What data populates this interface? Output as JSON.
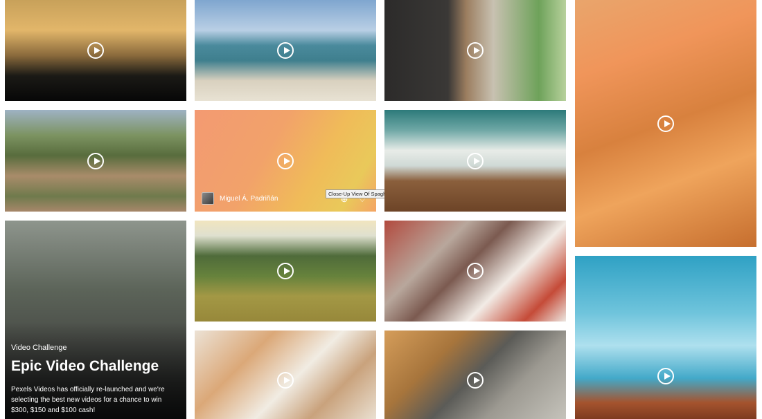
{
  "grid": {
    "tiles": [
      {
        "name": "sunset-coast-video",
        "bg": "linear-gradient(180deg,#c8a15a 0%,#e2b66a 30%,#8a6a3c 55%,#1b1a16 75%,#070707 100%)"
      },
      {
        "name": "beach-waves-video",
        "bg": "linear-gradient(180deg,#7fa6cf 0%,#b9cfe5 30%,#4a8a9c 45%,#3f7f8e 60%,#d9d1bf 80%,#e8e2d3 100%)"
      },
      {
        "name": "dog-window-video",
        "bg": "linear-gradient(90deg,#2c2b2a 0%,#3a3836 35%,#9b7d5f 45%,#c8c1b1 60%,#6ea25a 85%,#b7d19c 100%)"
      },
      {
        "name": "coffee-flowers-video",
        "bg": "linear-gradient(160deg,#e9a56c 0%,#f0955a 25%,#d8813e 50%,#efa45c 70%,#c66e2e 100%)"
      },
      {
        "name": "aerial-village-video",
        "bg": "linear-gradient(180deg,#9eb2c3 0%,#7c9361 25%,#586c3d 45%,#a98c6a 65%,#6f7a4c 85%,#a7876a 100%)"
      },
      {
        "name": "spaghetti-noodles-video",
        "bg": "linear-gradient(120deg,#f39a72 0%,#f2a26a 40%,#f0bb59 65%,#e9c95a 85%,#f4a464 100%)"
      },
      {
        "name": "ocean-shore-aerial-video",
        "bg": "linear-gradient(180deg,#2d7a7a 0%,#6fa8a6 20%,#e8ece8 40%,#cfd9d5 55%,#8a5f3c 70%,#6d4427 100%)"
      },
      {
        "name": "road-forest-video",
        "bg": "linear-gradient(180deg,#8e958d 0%,#5c6459 35%,#4a4d48 60%,#3a3c3a 80%,#1c1d1e 100%)"
      },
      {
        "name": "cows-field-video",
        "bg": "linear-gradient(180deg,#f1e5bf 0%,#dfe0cf 15%,#4f6b3a 35%,#66823c 55%,#a39845 75%,#97883a 100%)"
      },
      {
        "name": "plaid-shirt-phone-video",
        "bg": "linear-gradient(135deg,#b24a3e 0%,#b8a79c 30%,#7b5a50 45%,#f2ece6 65%,#c54b38 85%,#ece6e0 100%)"
      },
      {
        "name": "sky-building-video",
        "bg": "linear-gradient(180deg,#2fa1c4 0%,#6fc4dc 35%,#aee0ee 55%,#43a9c9 75%,#a5532e 90%,#7e3b20 100%)"
      },
      {
        "name": "latte-milk-pour-video",
        "bg": "linear-gradient(135deg,#ece2d5 0%,#dba878 30%,#f1ece3 55%,#c9a27c 75%,#eae0d1 100%)"
      },
      {
        "name": "rolling-pin-baking-video",
        "bg": "linear-gradient(135deg,#d59d5a 0%,#a7753c 30%,#5b5b57 50%,#9c9991 70%,#c5c3bb 100%)"
      }
    ],
    "spaghetti_hover": {
      "author_name": "Miguel Á. Padriñán",
      "tooltip": "Close-Up View Of Spaghetti Noodles"
    },
    "promo": {
      "label": "Video Challenge",
      "title": "Epic Video Challenge",
      "description": "Pexels Videos has officially re-launched and we're selecting the best new videos for a chance to win $300, $150 and $100 cash!"
    },
    "icons": {
      "play": "play-circle-icon",
      "collect": "plus-circle-icon",
      "like": "heart-icon"
    }
  }
}
